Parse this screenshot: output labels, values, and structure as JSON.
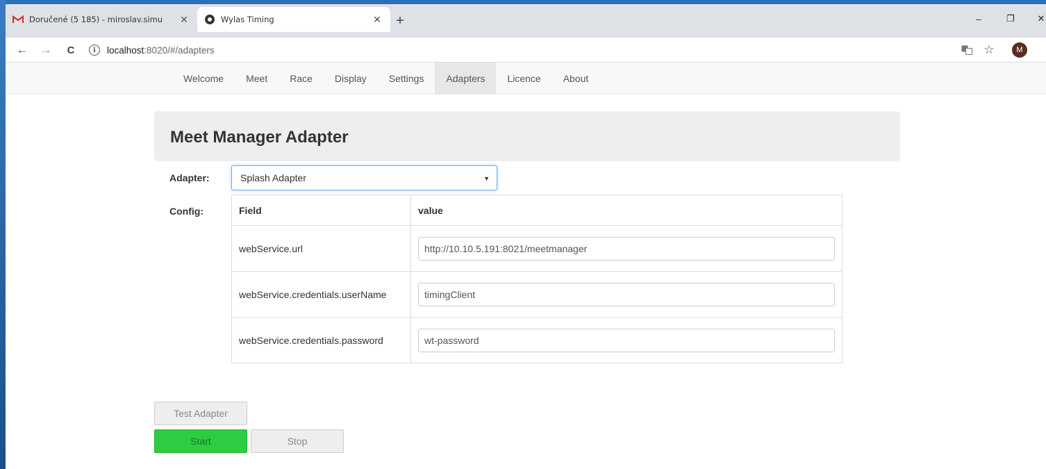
{
  "browser": {
    "tabs": [
      {
        "title": "Doručené (5 185) - miroslav.simu",
        "icon": "gmail-icon",
        "close": "✕"
      },
      {
        "title": "Wylas Timing",
        "icon": "wylas-icon",
        "close": "✕"
      }
    ],
    "new_tab": "+",
    "window_controls": {
      "minimize": "–",
      "restore": "❐",
      "close": "✕"
    },
    "nav": {
      "back": "←",
      "forward": "→",
      "reload": "C"
    },
    "address": {
      "host": "localhost",
      "path": ":8020/#/adapters"
    },
    "avatar_initial": "M"
  },
  "appnav": {
    "items": [
      "Welcome",
      "Meet",
      "Race",
      "Display",
      "Settings",
      "Adapters",
      "Licence",
      "About"
    ],
    "active": "Adapters"
  },
  "page": {
    "title": "Meet Manager Adapter",
    "adapter_label": "Adapter:",
    "adapter_value": "Splash Adapter",
    "config_label": "Config:",
    "table": {
      "headers": {
        "field": "Field",
        "value": "value"
      },
      "rows": [
        {
          "field": "webService.url",
          "value": "http://10.10.5.191:8021/meetmanager"
        },
        {
          "field": "webService.credentials.userName",
          "value": "timingClient"
        },
        {
          "field": "webService.credentials.password",
          "value": "wt-password"
        }
      ]
    },
    "buttons": {
      "test": "Test Adapter",
      "start": "Start",
      "stop": "Stop"
    }
  },
  "colors": {
    "start_button": "#2ecc40",
    "focus_border": "#66afe9",
    "desktop": "#1f5d9c"
  }
}
